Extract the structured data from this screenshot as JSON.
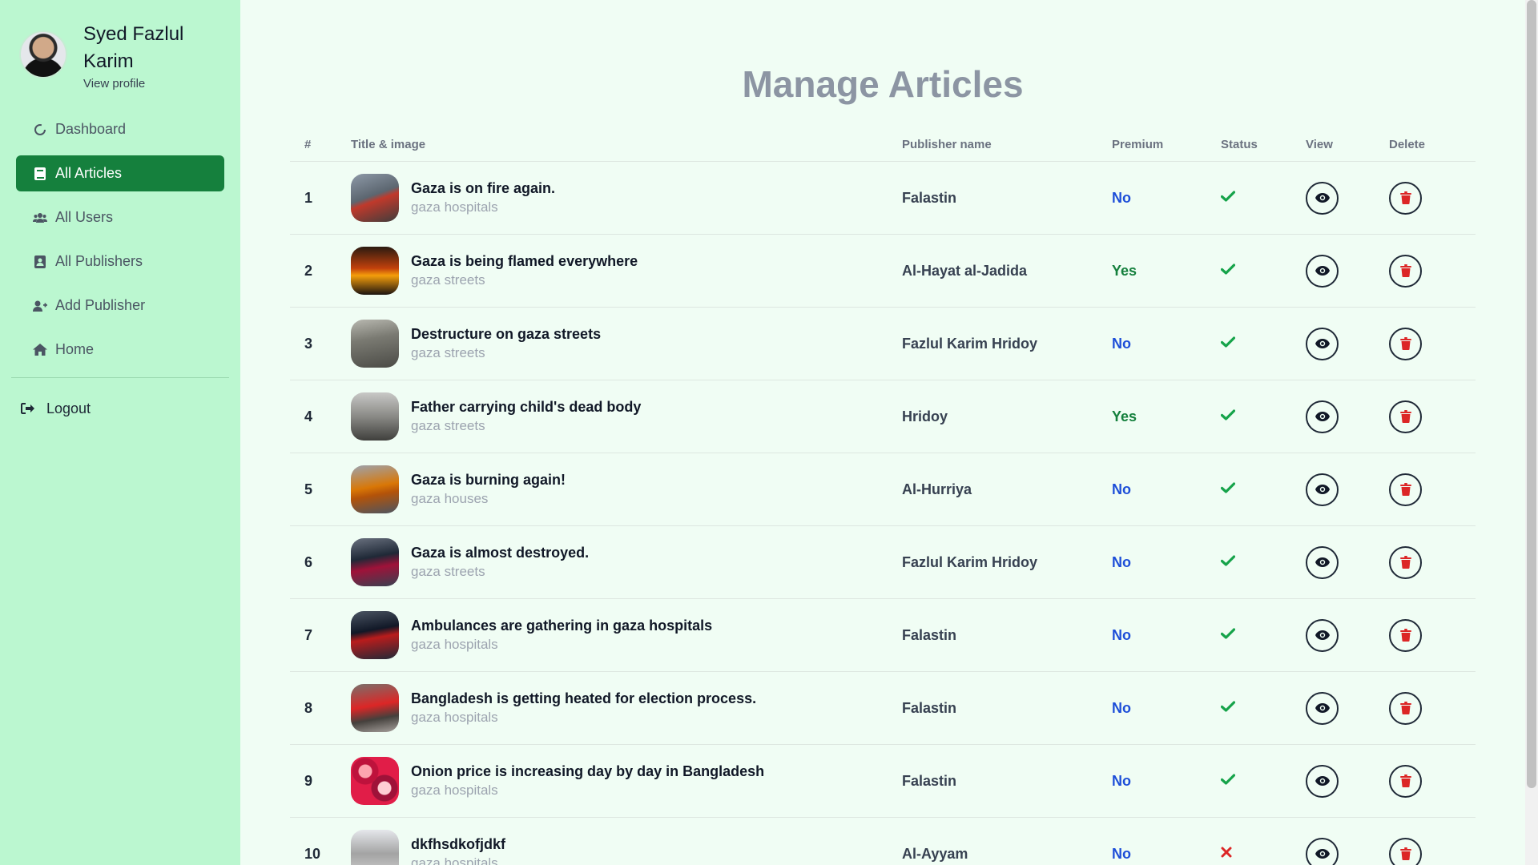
{
  "profile": {
    "name": "Syed Fazlul Karim",
    "link": "View profile"
  },
  "nav": [
    {
      "label": "Dashboard",
      "icon": "circle-notch-icon",
      "active": false
    },
    {
      "label": "All Articles",
      "icon": "book-icon",
      "active": true
    },
    {
      "label": "All Users",
      "icon": "users-icon",
      "active": false
    },
    {
      "label": "All Publishers",
      "icon": "address-book-icon",
      "active": false
    },
    {
      "label": "Add Publisher",
      "icon": "user-plus-icon",
      "active": false
    },
    {
      "label": "Home",
      "icon": "home-icon",
      "active": false
    }
  ],
  "logout": "Logout",
  "page_title": "Manage Articles",
  "table": {
    "headers": {
      "num": "#",
      "title": "Title & image",
      "publisher": "Publisher name",
      "premium": "Premium",
      "status": "Status",
      "view": "View",
      "delete": "Delete"
    },
    "rows": [
      {
        "num": "1",
        "title": "Gaza is on fire again.",
        "tag": "gaza hospitals",
        "publisher": "Falastin",
        "premium": "No",
        "status": "approved"
      },
      {
        "num": "2",
        "title": "Gaza is being flamed everywhere",
        "tag": "gaza streets",
        "publisher": "Al-Hayat al-Jadida",
        "premium": "Yes",
        "status": "approved"
      },
      {
        "num": "3",
        "title": "Destructure on gaza streets",
        "tag": "gaza streets",
        "publisher": "Fazlul Karim Hridoy",
        "premium": "No",
        "status": "approved"
      },
      {
        "num": "4",
        "title": "Father carrying child's dead body",
        "tag": "gaza streets",
        "publisher": "Hridoy",
        "premium": "Yes",
        "status": "approved"
      },
      {
        "num": "5",
        "title": "Gaza is burning again!",
        "tag": "gaza houses",
        "publisher": "Al-Hurriya",
        "premium": "No",
        "status": "approved"
      },
      {
        "num": "6",
        "title": "Gaza is almost destroyed.",
        "tag": "gaza streets",
        "publisher": "Fazlul Karim Hridoy",
        "premium": "No",
        "status": "approved"
      },
      {
        "num": "7",
        "title": "Ambulances are gathering in gaza hospitals",
        "tag": "gaza hospitals",
        "publisher": "Falastin",
        "premium": "No",
        "status": "approved"
      },
      {
        "num": "8",
        "title": "Bangladesh is getting heated for election process.",
        "tag": "gaza hospitals",
        "publisher": "Falastin",
        "premium": "No",
        "status": "approved"
      },
      {
        "num": "9",
        "title": "Onion price is increasing day by day in Bangladesh",
        "tag": "gaza hospitals",
        "publisher": "Falastin",
        "premium": "No",
        "status": "approved"
      },
      {
        "num": "10",
        "title": "dkfhsdkofjdkf",
        "tag": "gaza hospitals",
        "publisher": "Al-Ayyam",
        "premium": "No",
        "status": "rejected"
      }
    ]
  },
  "colors": {
    "sidebar_bg": "#bbf7d0",
    "active_nav": "#15803d",
    "page_bg": "#f0fdf4",
    "premium_no": "#1d4ed8",
    "premium_yes": "#15803d",
    "check": "#16a34a",
    "cross": "#dc2626",
    "delete": "#dc2626"
  }
}
